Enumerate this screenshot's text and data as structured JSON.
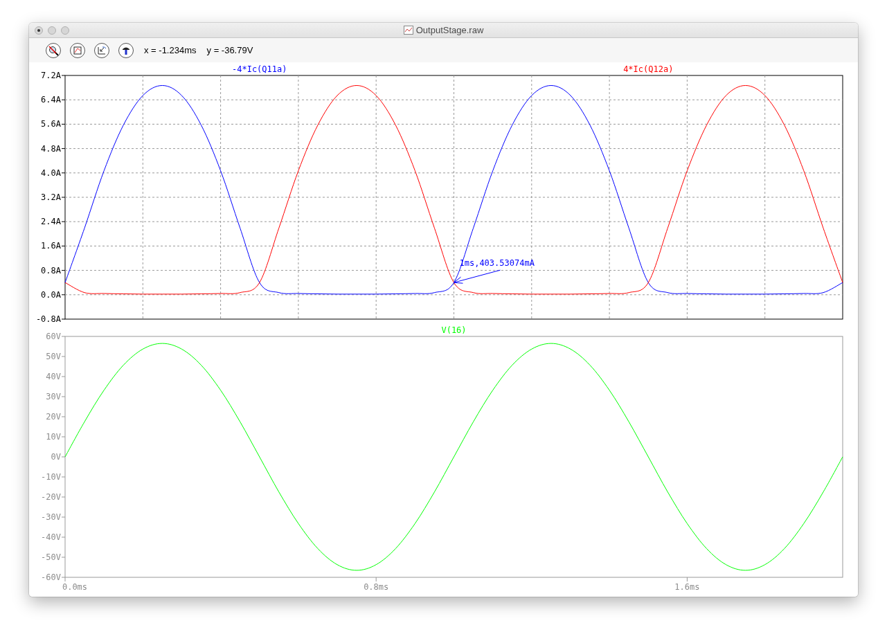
{
  "window": {
    "title": "OutputStage.raw"
  },
  "toolbar": {
    "cursor_x": "x = -1.234ms",
    "cursor_y": "y = -36.79V"
  },
  "panes": [
    {
      "chart_data": {
        "grid": true,
        "type": "line",
        "x": [
          0,
          0.05,
          0.1,
          0.15,
          0.2,
          0.25,
          0.3,
          0.35,
          0.4,
          0.45,
          0.5,
          0.55,
          0.6,
          0.65,
          0.7,
          0.75,
          0.8,
          0.85,
          0.9,
          0.95,
          1.0,
          1.05,
          1.1,
          1.15,
          1.2,
          1.25,
          1.3,
          1.35,
          1.4,
          1.45,
          1.5,
          1.55,
          1.6,
          1.65,
          1.7,
          1.75,
          1.8,
          1.85,
          1.9,
          1.95,
          2.0
        ],
        "series": [
          {
            "name": "-4*Ic(Q11a)",
            "color": "#0000ff",
            "values": [
              0.4,
              2.19,
              4.07,
              5.57,
              6.54,
              6.87,
              6.54,
              5.57,
              4.07,
              2.19,
              0.4,
              0.07,
              0.04,
              0.03,
              0.02,
              0.02,
              0.02,
              0.03,
              0.04,
              0.07,
              0.4,
              2.19,
              4.07,
              5.57,
              6.54,
              6.87,
              6.54,
              5.57,
              4.07,
              2.19,
              0.4,
              0.07,
              0.04,
              0.03,
              0.02,
              0.02,
              0.02,
              0.03,
              0.04,
              0.07,
              0.4
            ]
          },
          {
            "name": "4*Ic(Q12a)",
            "color": "#ff0000",
            "values": [
              0.4,
              0.07,
              0.04,
              0.03,
              0.02,
              0.02,
              0.02,
              0.03,
              0.04,
              0.07,
              0.4,
              2.19,
              4.07,
              5.57,
              6.54,
              6.87,
              6.54,
              5.57,
              4.07,
              2.19,
              0.4,
              0.07,
              0.04,
              0.03,
              0.02,
              0.02,
              0.02,
              0.03,
              0.04,
              0.07,
              0.4,
              2.19,
              4.07,
              5.57,
              6.54,
              6.87,
              6.54,
              5.57,
              4.07,
              2.19,
              0.4
            ]
          }
        ],
        "xlim": [
          0,
          2
        ],
        "ylim": [
          -0.8,
          7.2
        ],
        "yticks": [
          {
            "value": -0.8,
            "label": "-0.8A"
          },
          {
            "value": 0,
            "label": "0.0A"
          },
          {
            "value": 0.8,
            "label": "0.8A"
          },
          {
            "value": 1.6,
            "label": "1.6A"
          },
          {
            "value": 2.4,
            "label": "2.4A"
          },
          {
            "value": 3.2,
            "label": "3.2A"
          },
          {
            "value": 4.0,
            "label": "4.0A"
          },
          {
            "value": 4.8,
            "label": "4.8A"
          },
          {
            "value": 5.6,
            "label": "5.6A"
          },
          {
            "value": 6.4,
            "label": "6.4A"
          },
          {
            "value": 7.2,
            "label": "7.2A"
          }
        ],
        "annotations": [
          {
            "text": "1ms,403.53074mA",
            "x": 1.0,
            "y": 0.4
          }
        ]
      }
    },
    {
      "chart_data": {
        "grid": false,
        "type": "line",
        "x": [
          0,
          0.05,
          0.1,
          0.15,
          0.2,
          0.25,
          0.3,
          0.35,
          0.4,
          0.45,
          0.5,
          0.55,
          0.6,
          0.65,
          0.7,
          0.75,
          0.8,
          0.85,
          0.9,
          0.95,
          1.0,
          1.05,
          1.1,
          1.15,
          1.2,
          1.25,
          1.3,
          1.35,
          1.4,
          1.45,
          1.5,
          1.55,
          1.6,
          1.65,
          1.7,
          1.75,
          1.8,
          1.85,
          1.9,
          1.95,
          2.0
        ],
        "series": [
          {
            "name": "V(16)",
            "color": "#00ff00",
            "values": [
              0,
              17.5,
              33.2,
              45.7,
              53.7,
              56.5,
              53.7,
              45.7,
              33.2,
              17.5,
              0,
              -17.5,
              -33.2,
              -45.7,
              -53.7,
              -56.5,
              -53.7,
              -45.7,
              -33.2,
              -17.5,
              0,
              17.5,
              33.2,
              45.7,
              53.7,
              56.5,
              53.7,
              45.7,
              33.2,
              17.5,
              0,
              -17.5,
              -33.2,
              -45.7,
              -53.7,
              -56.5,
              -53.7,
              -45.7,
              -33.2,
              -17.5,
              0
            ]
          }
        ],
        "xlim": [
          0,
          2
        ],
        "ylim": [
          -60,
          60
        ],
        "xticks": [
          {
            "value": 0,
            "label": "0.0ms"
          },
          {
            "value": 0.8,
            "label": "0.8ms"
          },
          {
            "value": 1.6,
            "label": "1.6ms"
          }
        ],
        "yticks": [
          {
            "value": -60,
            "label": "-60V"
          },
          {
            "value": -50,
            "label": "-50V"
          },
          {
            "value": -40,
            "label": "-40V"
          },
          {
            "value": -30,
            "label": "-30V"
          },
          {
            "value": -20,
            "label": "-20V"
          },
          {
            "value": -10,
            "label": "-10V"
          },
          {
            "value": 0,
            "label": "0V"
          },
          {
            "value": 10,
            "label": "10V"
          },
          {
            "value": 20,
            "label": "20V"
          },
          {
            "value": 30,
            "label": "30V"
          },
          {
            "value": 40,
            "label": "40V"
          },
          {
            "value": 50,
            "label": "50V"
          },
          {
            "value": 60,
            "label": "60V"
          }
        ]
      }
    }
  ]
}
